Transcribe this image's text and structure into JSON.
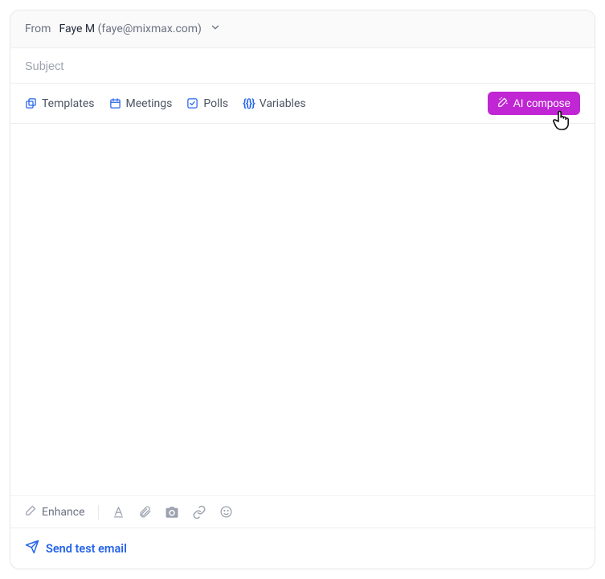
{
  "from": {
    "label": "From",
    "name": "Faye M",
    "email": "(faye@mixmax.com)"
  },
  "subject": {
    "placeholder": "Subject",
    "value": ""
  },
  "toolbar": {
    "templates_label": "Templates",
    "meetings_label": "Meetings",
    "polls_label": "Polls",
    "variables_label": "Variables",
    "variables_icon_text": "{{}}",
    "ai_compose_label": "AI compose"
  },
  "format": {
    "enhance_label": "Enhance"
  },
  "footer": {
    "send_test_label": "Send test email"
  }
}
